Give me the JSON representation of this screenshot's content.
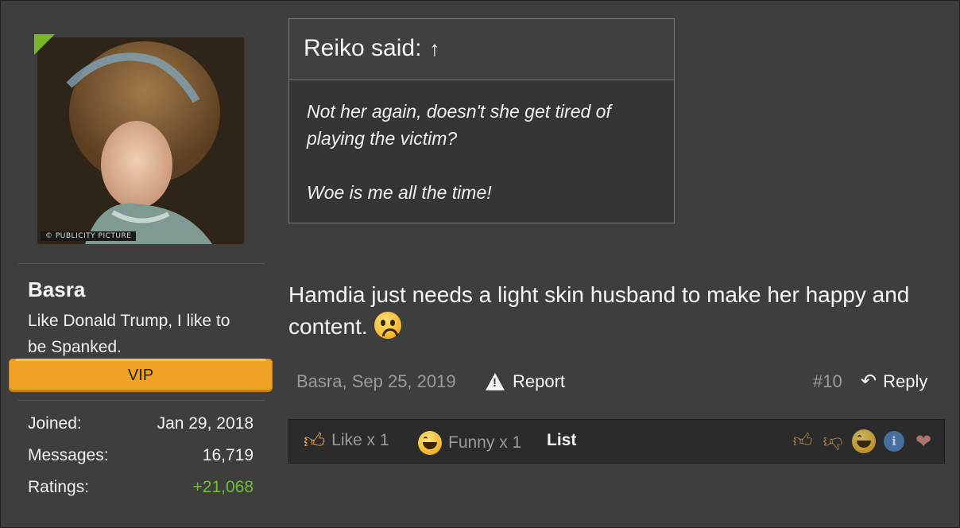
{
  "user": {
    "name": "Basra",
    "title": "Like Donald Trump, I like to be Spanked.",
    "badge": "VIP",
    "avatar_credit": "© PUBLICITY PICTURE",
    "stats": [
      {
        "label": "Joined:",
        "value": "Jan 29, 2018"
      },
      {
        "label": "Messages:",
        "value": "16,719"
      },
      {
        "label": "Ratings:",
        "value": "+21,068"
      }
    ]
  },
  "quote": {
    "header": "Reiko said:",
    "up_arrow": "↑",
    "lines": [
      "Not her again, doesn't she get tired of playing the victim?",
      "Woe is me all the time!"
    ]
  },
  "message": {
    "text": "Hamdia just needs a light skin husband to make her happy and content."
  },
  "meta": {
    "author_date": "Basra, Sep 25, 2019",
    "report_label": "Report",
    "post_number": "#10",
    "reply_label": "Reply"
  },
  "ratings": {
    "like": "Like x 1",
    "funny": "Funny x 1",
    "list_label": "List"
  },
  "colors": {
    "accent": "#f0a227",
    "online": "#78b62a",
    "positive": "#6fbf2a"
  }
}
